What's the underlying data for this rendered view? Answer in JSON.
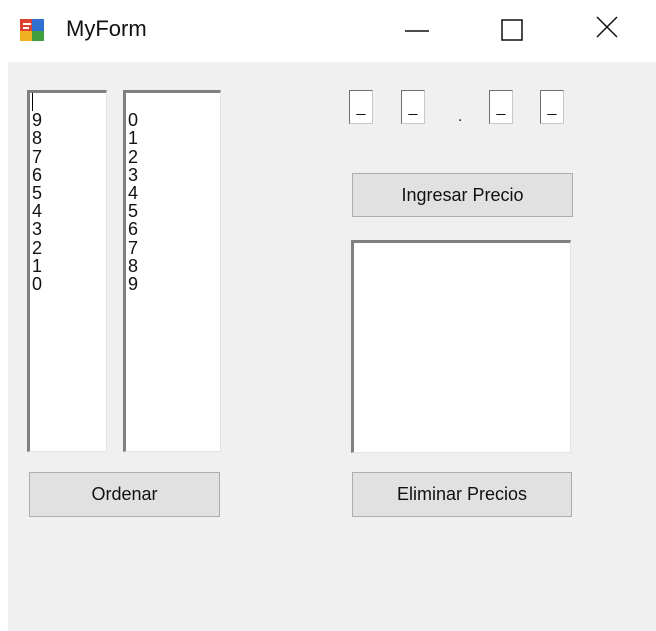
{
  "window": {
    "title": "MyForm",
    "icon": "form-app-icon",
    "controls": [
      "minimize-icon",
      "maximize-icon",
      "close-icon"
    ]
  },
  "left_list": {
    "items": [
      "",
      "9",
      "8",
      "7",
      "6",
      "5",
      "4",
      "3",
      "2",
      "1",
      "0"
    ]
  },
  "right_list": {
    "items": [
      "",
      "0",
      "1",
      "2",
      "3",
      "4",
      "5",
      "6",
      "7",
      "8",
      "9"
    ]
  },
  "price_inputs": {
    "digit1": "_",
    "digit2": "_",
    "separator": ".",
    "digit3": "_",
    "digit4": "_"
  },
  "buttons": {
    "ingresar": "Ingresar Precio",
    "eliminar": "Eliminar Precios",
    "ordenar": "Ordenar"
  },
  "prices_list": {
    "items": []
  }
}
